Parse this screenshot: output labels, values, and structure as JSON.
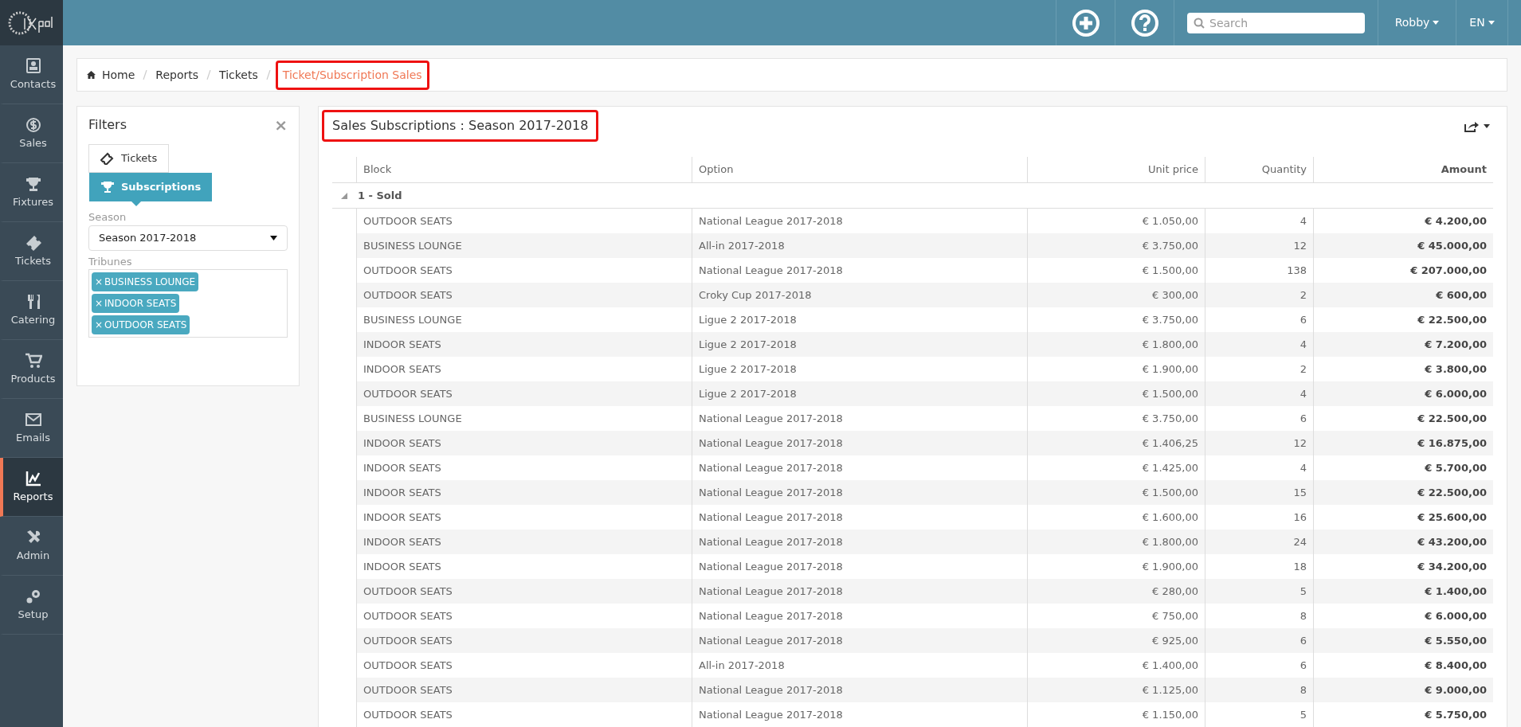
{
  "sidebar": {
    "items": [
      {
        "label": "Contacts",
        "selected": false
      },
      {
        "label": "Sales",
        "selected": false
      },
      {
        "label": "Fixtures",
        "selected": false
      },
      {
        "label": "Tickets",
        "selected": false
      },
      {
        "label": "Catering",
        "selected": false
      },
      {
        "label": "Products",
        "selected": false
      },
      {
        "label": "Emails",
        "selected": false
      },
      {
        "label": "Reports",
        "selected": true
      },
      {
        "label": "Admin",
        "selected": false
      },
      {
        "label": "Setup",
        "selected": false
      }
    ]
  },
  "topbar": {
    "search": {
      "placeholder": "Search"
    },
    "user": "Robby",
    "language": "EN"
  },
  "breadcrumb": [
    {
      "label": "Home",
      "current": false
    },
    {
      "label": "Reports",
      "current": false
    },
    {
      "label": "Tickets",
      "current": false
    },
    {
      "label": "Ticket/Subscription Sales",
      "current": true
    }
  ],
  "filters": {
    "title": "Filters",
    "close": "×",
    "tabs": [
      {
        "label": "Tickets",
        "selected": false
      },
      {
        "label": "Subscriptions",
        "selected": true
      }
    ],
    "season": {
      "label": "Season",
      "value": "Season 2017-2018"
    },
    "tribunes": {
      "label": "Tribunes",
      "tags": [
        {
          "remove": "×",
          "label": "BUSINESS LOUNGE"
        },
        {
          "remove": "×",
          "label": "INDOOR SEATS"
        },
        {
          "remove": "×",
          "label": "OUTDOOR SEATS"
        }
      ]
    }
  },
  "report": {
    "title": "Sales Subscriptions : Season 2017-2018",
    "columns": [
      "Block",
      "Option",
      "Unit price",
      "Quantity",
      "Amount"
    ],
    "group": {
      "label": "1 - Sold",
      "expanded": true
    },
    "rows": [
      [
        "OUTDOOR SEATS",
        "National League 2017-2018",
        "€ 1.050,00",
        "4",
        "€ 4.200,00"
      ],
      [
        "BUSINESS LOUNGE",
        "All-in 2017-2018",
        "€ 3.750,00",
        "12",
        "€ 45.000,00"
      ],
      [
        "OUTDOOR SEATS",
        "National League 2017-2018",
        "€ 1.500,00",
        "138",
        "€ 207.000,00"
      ],
      [
        "OUTDOOR SEATS",
        "Croky Cup 2017-2018",
        "€ 300,00",
        "2",
        "€ 600,00"
      ],
      [
        "BUSINESS LOUNGE",
        "Ligue 2 2017-2018",
        "€ 3.750,00",
        "6",
        "€ 22.500,00"
      ],
      [
        "INDOOR SEATS",
        "Ligue 2 2017-2018",
        "€ 1.800,00",
        "4",
        "€ 7.200,00"
      ],
      [
        "INDOOR SEATS",
        "Ligue 2 2017-2018",
        "€ 1.900,00",
        "2",
        "€ 3.800,00"
      ],
      [
        "OUTDOOR SEATS",
        "Ligue 2 2017-2018",
        "€ 1.500,00",
        "4",
        "€ 6.000,00"
      ],
      [
        "BUSINESS LOUNGE",
        "National League 2017-2018",
        "€ 3.750,00",
        "6",
        "€ 22.500,00"
      ],
      [
        "INDOOR SEATS",
        "National League 2017-2018",
        "€ 1.406,25",
        "12",
        "€ 16.875,00"
      ],
      [
        "INDOOR SEATS",
        "National League 2017-2018",
        "€ 1.425,00",
        "4",
        "€ 5.700,00"
      ],
      [
        "INDOOR SEATS",
        "National League 2017-2018",
        "€ 1.500,00",
        "15",
        "€ 22.500,00"
      ],
      [
        "INDOOR SEATS",
        "National League 2017-2018",
        "€ 1.600,00",
        "16",
        "€ 25.600,00"
      ],
      [
        "INDOOR SEATS",
        "National League 2017-2018",
        "€ 1.800,00",
        "24",
        "€ 43.200,00"
      ],
      [
        "INDOOR SEATS",
        "National League 2017-2018",
        "€ 1.900,00",
        "18",
        "€ 34.200,00"
      ],
      [
        "OUTDOOR SEATS",
        "National League 2017-2018",
        "€ 280,00",
        "5",
        "€ 1.400,00"
      ],
      [
        "OUTDOOR SEATS",
        "National League 2017-2018",
        "€ 750,00",
        "8",
        "€ 6.000,00"
      ],
      [
        "OUTDOOR SEATS",
        "National League 2017-2018",
        "€ 925,00",
        "6",
        "€ 5.550,00"
      ],
      [
        "OUTDOOR SEATS",
        "All-in 2017-2018",
        "€ 1.400,00",
        "6",
        "€ 8.400,00"
      ],
      [
        "OUTDOOR SEATS",
        "National League 2017-2018",
        "€ 1.125,00",
        "8",
        "€ 9.000,00"
      ],
      [
        "OUTDOOR SEATS",
        "National League 2017-2018",
        "€ 1.150,00",
        "5",
        "€ 5.750,00"
      ]
    ]
  }
}
